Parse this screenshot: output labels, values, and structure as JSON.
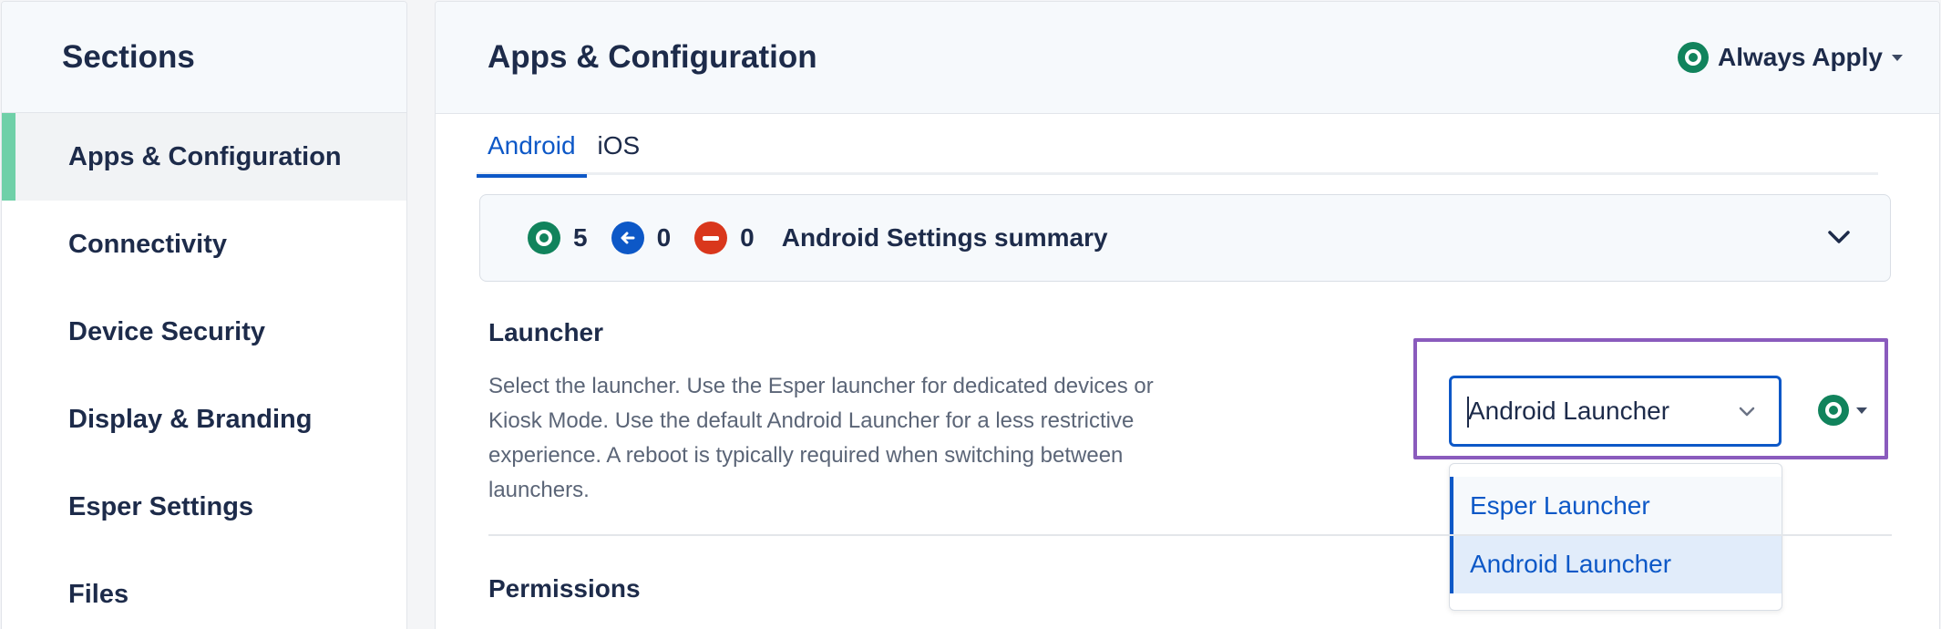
{
  "sidebar": {
    "title": "Sections",
    "items": [
      {
        "label": "Apps & Configuration",
        "active": true
      },
      {
        "label": "Connectivity"
      },
      {
        "label": "Device Security"
      },
      {
        "label": "Display & Branding"
      },
      {
        "label": "Esper Settings"
      },
      {
        "label": "Files"
      }
    ]
  },
  "header": {
    "title": "Apps & Configuration",
    "apply_label": "Always Apply",
    "apply_icon": "ring-icon"
  },
  "tabs": [
    {
      "label": "Android",
      "active": true
    },
    {
      "label": "iOS"
    }
  ],
  "summary": {
    "applied_count": "5",
    "inherited_count": "0",
    "removed_count": "0",
    "title": "Android Settings summary",
    "icons": [
      "applied-ring-icon",
      "arrow-left-icon",
      "minus-icon",
      "chevron-down-icon"
    ]
  },
  "launcher": {
    "title": "Launcher",
    "description": "Select the launcher. Use the Esper launcher for dedicated devices or Kiosk Mode. Use the default Android Launcher for a less restrictive experience. A reboot is typically required when switching between launchers.",
    "selected_value": "Android Launcher",
    "options": [
      "Esper Launcher",
      "Android Launcher"
    ]
  },
  "permissions": {
    "title": "Permissions"
  },
  "colors": {
    "accent": "#0d58c7",
    "applied": "#11835c",
    "removed": "#d9371c",
    "sidebar_active_bar": "#6fd0a8",
    "highlight_box": "#8a5bbd"
  }
}
